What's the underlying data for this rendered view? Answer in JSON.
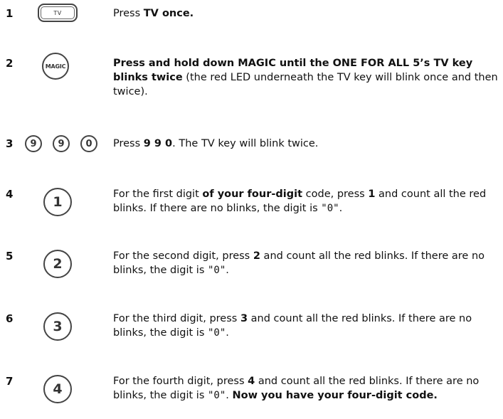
{
  "steps": [
    {
      "number": "1",
      "key_label": "TV",
      "text": [
        {
          "t": "Press ",
          "b": false
        },
        {
          "t": "TV once.",
          "b": true
        }
      ]
    },
    {
      "number": "2",
      "key_label": "MAGIC",
      "text": [
        {
          "t": "Press and hold down MAGIC until the ONE FOR ALL 5’s TV key blinks twice",
          "b": true
        },
        {
          "t": " (the red LED underneath the TV key will blink once and then twice).",
          "b": false
        }
      ]
    },
    {
      "number": "3",
      "key_labels": [
        "9",
        "9",
        "0"
      ],
      "text": [
        {
          "t": "Press ",
          "b": false
        },
        {
          "t": "9 9 0",
          "b": true
        },
        {
          "t": ". The TV key will blink twice.",
          "b": false
        }
      ]
    },
    {
      "number": "4",
      "key_label": "1",
      "text": [
        {
          "t": "For the first digit ",
          "b": false
        },
        {
          "t": "of your four-digit",
          "b": true
        },
        {
          "t": " code, press ",
          "b": false
        },
        {
          "t": "1",
          "b": true
        },
        {
          "t": " and count all the red blinks. If there are no blinks, the digit is ",
          "b": false
        },
        {
          "t": "\"0\"",
          "m": true
        },
        {
          "t": ".",
          "b": false
        }
      ]
    },
    {
      "number": "5",
      "key_label": "2",
      "text": [
        {
          "t": "For the second digit, press ",
          "b": false
        },
        {
          "t": "2",
          "b": true
        },
        {
          "t": " and count all the red blinks. If there are no blinks, the digit is ",
          "b": false
        },
        {
          "t": "\"0\"",
          "m": true
        },
        {
          "t": ".",
          "b": false
        }
      ]
    },
    {
      "number": "6",
      "key_label": "3",
      "text": [
        {
          "t": "For the third digit, press ",
          "b": false
        },
        {
          "t": "3",
          "b": true
        },
        {
          "t": " and count all the red blinks. If there are no blinks, the digit is ",
          "b": false
        },
        {
          "t": "\"0\"",
          "m": true
        },
        {
          "t": ".",
          "b": false
        }
      ]
    },
    {
      "number": "7",
      "key_label": "4",
      "text": [
        {
          "t": "For the fourth digit, press ",
          "b": false
        },
        {
          "t": "4",
          "b": true
        },
        {
          "t": " and count all the red blinks. If there are no blinks, the digit is ",
          "b": false
        },
        {
          "t": "\"0\"",
          "m": true
        },
        {
          "t": ". ",
          "b": false
        },
        {
          "t": "Now you have your four-digit code.",
          "b": true
        }
      ]
    }
  ]
}
